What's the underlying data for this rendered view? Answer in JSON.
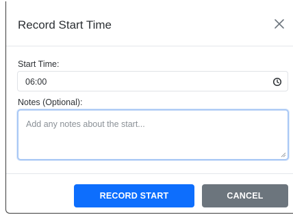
{
  "dialog": {
    "title": "Record Start Time",
    "close_icon": "close-icon"
  },
  "form": {
    "start_time_label": "Start Time:",
    "start_time_value": "06:00",
    "clock_icon": "clock-icon",
    "notes_label": "Notes (Optional):",
    "notes_placeholder": "Add any notes about the start...",
    "notes_value": ""
  },
  "footer": {
    "record_start_label": "RECORD START",
    "cancel_label": "CANCEL"
  },
  "colors": {
    "primary": "#0d6efd",
    "secondary": "#6c757d",
    "focus_border": "#a9c8f5"
  }
}
